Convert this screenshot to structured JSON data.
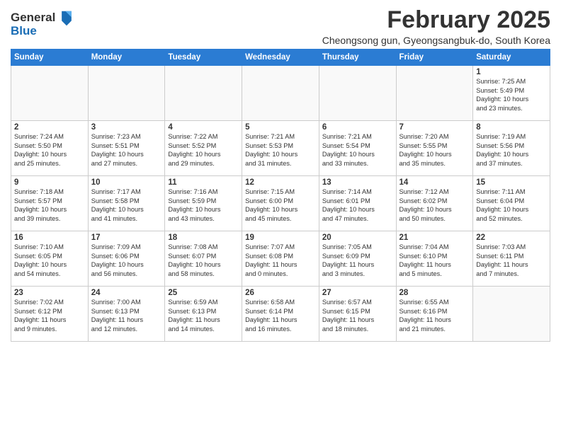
{
  "logo": {
    "general": "General",
    "blue": "Blue"
  },
  "header": {
    "title": "February 2025",
    "subtitle": "Cheongsong gun, Gyeongsangbuk-do, South Korea"
  },
  "days_of_week": [
    "Sunday",
    "Monday",
    "Tuesday",
    "Wednesday",
    "Thursday",
    "Friday",
    "Saturday"
  ],
  "weeks": [
    [
      {
        "day": "",
        "info": ""
      },
      {
        "day": "",
        "info": ""
      },
      {
        "day": "",
        "info": ""
      },
      {
        "day": "",
        "info": ""
      },
      {
        "day": "",
        "info": ""
      },
      {
        "day": "",
        "info": ""
      },
      {
        "day": "1",
        "info": "Sunrise: 7:25 AM\nSunset: 5:49 PM\nDaylight: 10 hours\nand 23 minutes."
      }
    ],
    [
      {
        "day": "2",
        "info": "Sunrise: 7:24 AM\nSunset: 5:50 PM\nDaylight: 10 hours\nand 25 minutes."
      },
      {
        "day": "3",
        "info": "Sunrise: 7:23 AM\nSunset: 5:51 PM\nDaylight: 10 hours\nand 27 minutes."
      },
      {
        "day": "4",
        "info": "Sunrise: 7:22 AM\nSunset: 5:52 PM\nDaylight: 10 hours\nand 29 minutes."
      },
      {
        "day": "5",
        "info": "Sunrise: 7:21 AM\nSunset: 5:53 PM\nDaylight: 10 hours\nand 31 minutes."
      },
      {
        "day": "6",
        "info": "Sunrise: 7:21 AM\nSunset: 5:54 PM\nDaylight: 10 hours\nand 33 minutes."
      },
      {
        "day": "7",
        "info": "Sunrise: 7:20 AM\nSunset: 5:55 PM\nDaylight: 10 hours\nand 35 minutes."
      },
      {
        "day": "8",
        "info": "Sunrise: 7:19 AM\nSunset: 5:56 PM\nDaylight: 10 hours\nand 37 minutes."
      }
    ],
    [
      {
        "day": "9",
        "info": "Sunrise: 7:18 AM\nSunset: 5:57 PM\nDaylight: 10 hours\nand 39 minutes."
      },
      {
        "day": "10",
        "info": "Sunrise: 7:17 AM\nSunset: 5:58 PM\nDaylight: 10 hours\nand 41 minutes."
      },
      {
        "day": "11",
        "info": "Sunrise: 7:16 AM\nSunset: 5:59 PM\nDaylight: 10 hours\nand 43 minutes."
      },
      {
        "day": "12",
        "info": "Sunrise: 7:15 AM\nSunset: 6:00 PM\nDaylight: 10 hours\nand 45 minutes."
      },
      {
        "day": "13",
        "info": "Sunrise: 7:14 AM\nSunset: 6:01 PM\nDaylight: 10 hours\nand 47 minutes."
      },
      {
        "day": "14",
        "info": "Sunrise: 7:12 AM\nSunset: 6:02 PM\nDaylight: 10 hours\nand 50 minutes."
      },
      {
        "day": "15",
        "info": "Sunrise: 7:11 AM\nSunset: 6:04 PM\nDaylight: 10 hours\nand 52 minutes."
      }
    ],
    [
      {
        "day": "16",
        "info": "Sunrise: 7:10 AM\nSunset: 6:05 PM\nDaylight: 10 hours\nand 54 minutes."
      },
      {
        "day": "17",
        "info": "Sunrise: 7:09 AM\nSunset: 6:06 PM\nDaylight: 10 hours\nand 56 minutes."
      },
      {
        "day": "18",
        "info": "Sunrise: 7:08 AM\nSunset: 6:07 PM\nDaylight: 10 hours\nand 58 minutes."
      },
      {
        "day": "19",
        "info": "Sunrise: 7:07 AM\nSunset: 6:08 PM\nDaylight: 11 hours\nand 0 minutes."
      },
      {
        "day": "20",
        "info": "Sunrise: 7:05 AM\nSunset: 6:09 PM\nDaylight: 11 hours\nand 3 minutes."
      },
      {
        "day": "21",
        "info": "Sunrise: 7:04 AM\nSunset: 6:10 PM\nDaylight: 11 hours\nand 5 minutes."
      },
      {
        "day": "22",
        "info": "Sunrise: 7:03 AM\nSunset: 6:11 PM\nDaylight: 11 hours\nand 7 minutes."
      }
    ],
    [
      {
        "day": "23",
        "info": "Sunrise: 7:02 AM\nSunset: 6:12 PM\nDaylight: 11 hours\nand 9 minutes."
      },
      {
        "day": "24",
        "info": "Sunrise: 7:00 AM\nSunset: 6:13 PM\nDaylight: 11 hours\nand 12 minutes."
      },
      {
        "day": "25",
        "info": "Sunrise: 6:59 AM\nSunset: 6:13 PM\nDaylight: 11 hours\nand 14 minutes."
      },
      {
        "day": "26",
        "info": "Sunrise: 6:58 AM\nSunset: 6:14 PM\nDaylight: 11 hours\nand 16 minutes."
      },
      {
        "day": "27",
        "info": "Sunrise: 6:57 AM\nSunset: 6:15 PM\nDaylight: 11 hours\nand 18 minutes."
      },
      {
        "day": "28",
        "info": "Sunrise: 6:55 AM\nSunset: 6:16 PM\nDaylight: 11 hours\nand 21 minutes."
      },
      {
        "day": "",
        "info": ""
      }
    ]
  ]
}
